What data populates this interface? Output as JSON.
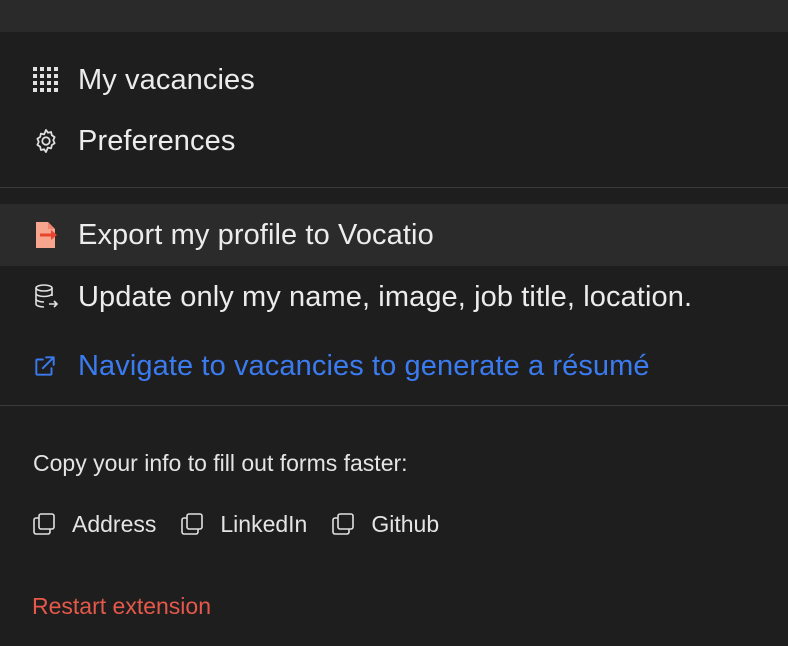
{
  "menu": {
    "items": [
      {
        "icon": "grid-icon",
        "label": "My vacancies"
      },
      {
        "icon": "gear-icon",
        "label": "Preferences"
      }
    ]
  },
  "actions": {
    "export": {
      "icon": "export-document-icon",
      "label": "Export my profile to Vocatio",
      "icon_color": "#f0846c"
    },
    "update": {
      "icon": "database-sync-icon",
      "label": "Update only my name, image, job title, location."
    },
    "navigate": {
      "icon": "external-link-icon",
      "label": "Navigate to vacancies to generate a résumé",
      "color": "#3b7bf0"
    }
  },
  "copy": {
    "heading": "Copy your info to fill out forms faster:",
    "items": [
      {
        "icon": "copy-icon",
        "label": "Address"
      },
      {
        "icon": "copy-icon",
        "label": "LinkedIn"
      },
      {
        "icon": "copy-icon",
        "label": "Github"
      }
    ]
  },
  "footer": {
    "restart_label": "Restart extension",
    "restart_color": "#e5584a"
  }
}
